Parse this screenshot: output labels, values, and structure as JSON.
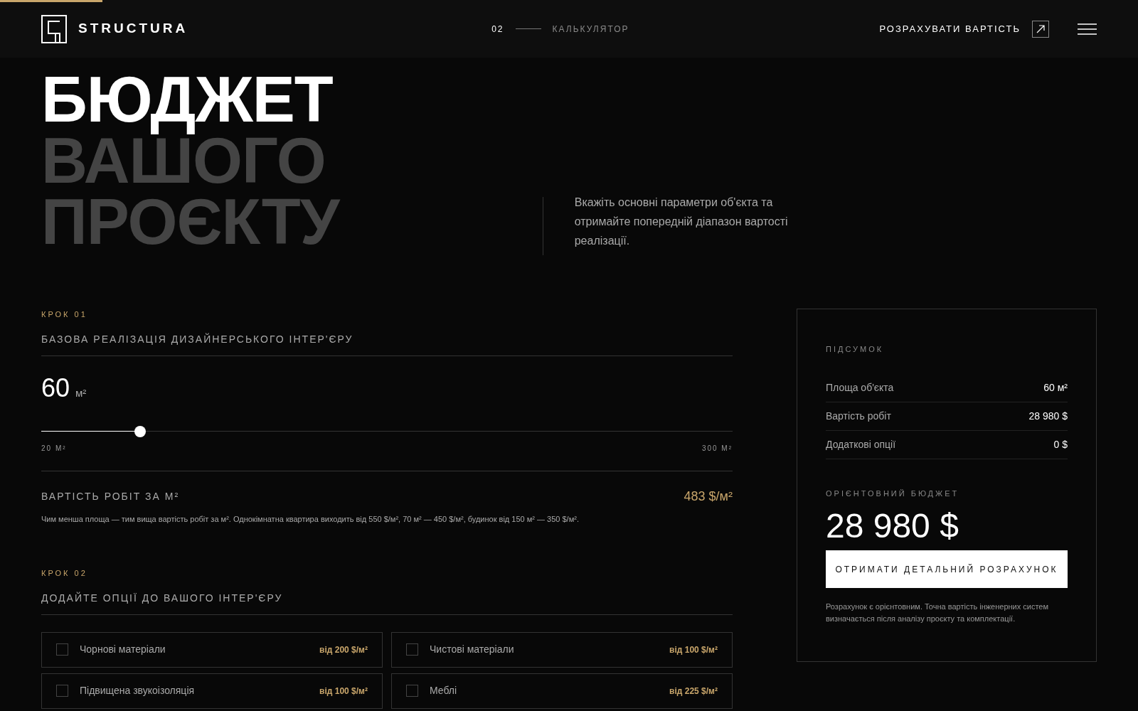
{
  "progress": {
    "level": 0.09
  },
  "header": {
    "logo": "STRUCTURA",
    "step_number": "02",
    "step_label": "КАЛЬКУЛЯТОР",
    "cta": "РОЗРАХУВАТИ ВАРТІСТЬ"
  },
  "hero": {
    "title_lines": [
      {
        "text": "БЮДЖЕТ",
        "muted": false
      },
      {
        "text": "ВАШОГО",
        "muted": true
      },
      {
        "text": "ПРОЄКТУ",
        "muted": true
      }
    ],
    "description": "Вкажіть основні параметри об'єкта та отримайте попередній діапазон вартості реалізації."
  },
  "step1": {
    "step": "КРОК 01",
    "title": "БАЗОВА РЕАЛІЗАЦІЯ ДИЗАЙНЕРСЬКОГО ІНТЕР'ЄРУ",
    "area_value": "60",
    "area_unit": "м²",
    "slider": {
      "level": 0.143,
      "min_label": "20 М²",
      "max_label": "300 М²"
    },
    "rate_label": "ВАРТІСТЬ РОБІТ ЗА М²",
    "rate_value": "483 $/м²",
    "note": "Чим менша площа — тим вища вартість робіт за м². Однокімнатна квартира виходить від 550 $/м², 70 м² — 450 $/м², будинок від 150 м² — 350 $/м²."
  },
  "step2": {
    "step": "КРОК 02",
    "title": "ДОДАЙТЕ ОПЦІЇ ДО ВАШОГО ІНТЕР'ЄРУ",
    "options": [
      {
        "label": "Чорнові матеріали",
        "price": "від 200 $/м²",
        "checked": false
      },
      {
        "label": "Чистові матеріали",
        "price": "від 100 $/м²",
        "checked": false
      },
      {
        "label": "Підвищена звукоізоляція",
        "price": "від 100 $/м²",
        "checked": false
      },
      {
        "label": "Меблі",
        "price": "від 225 $/м²",
        "checked": false
      }
    ]
  },
  "summary": {
    "title": "ПІДСУМОК",
    "rows": [
      {
        "label": "Площа об'єкта",
        "value": "60 м²"
      },
      {
        "label": "Вартість робіт",
        "value": "28 980 $"
      },
      {
        "label": "Додаткові опції",
        "value": "0 $"
      }
    ],
    "budget_label": "ОРІЄНТОВНИЙ БЮДЖЕТ",
    "budget_value": "28 980 $",
    "button": "ОТРИМАТИ ДЕТАЛЬНИЙ РОЗРАХУНОК",
    "note": "Розрахунок є орієнтовним. Точна вартість інженерних систем визначається після аналізу проєкту та комплектації."
  }
}
